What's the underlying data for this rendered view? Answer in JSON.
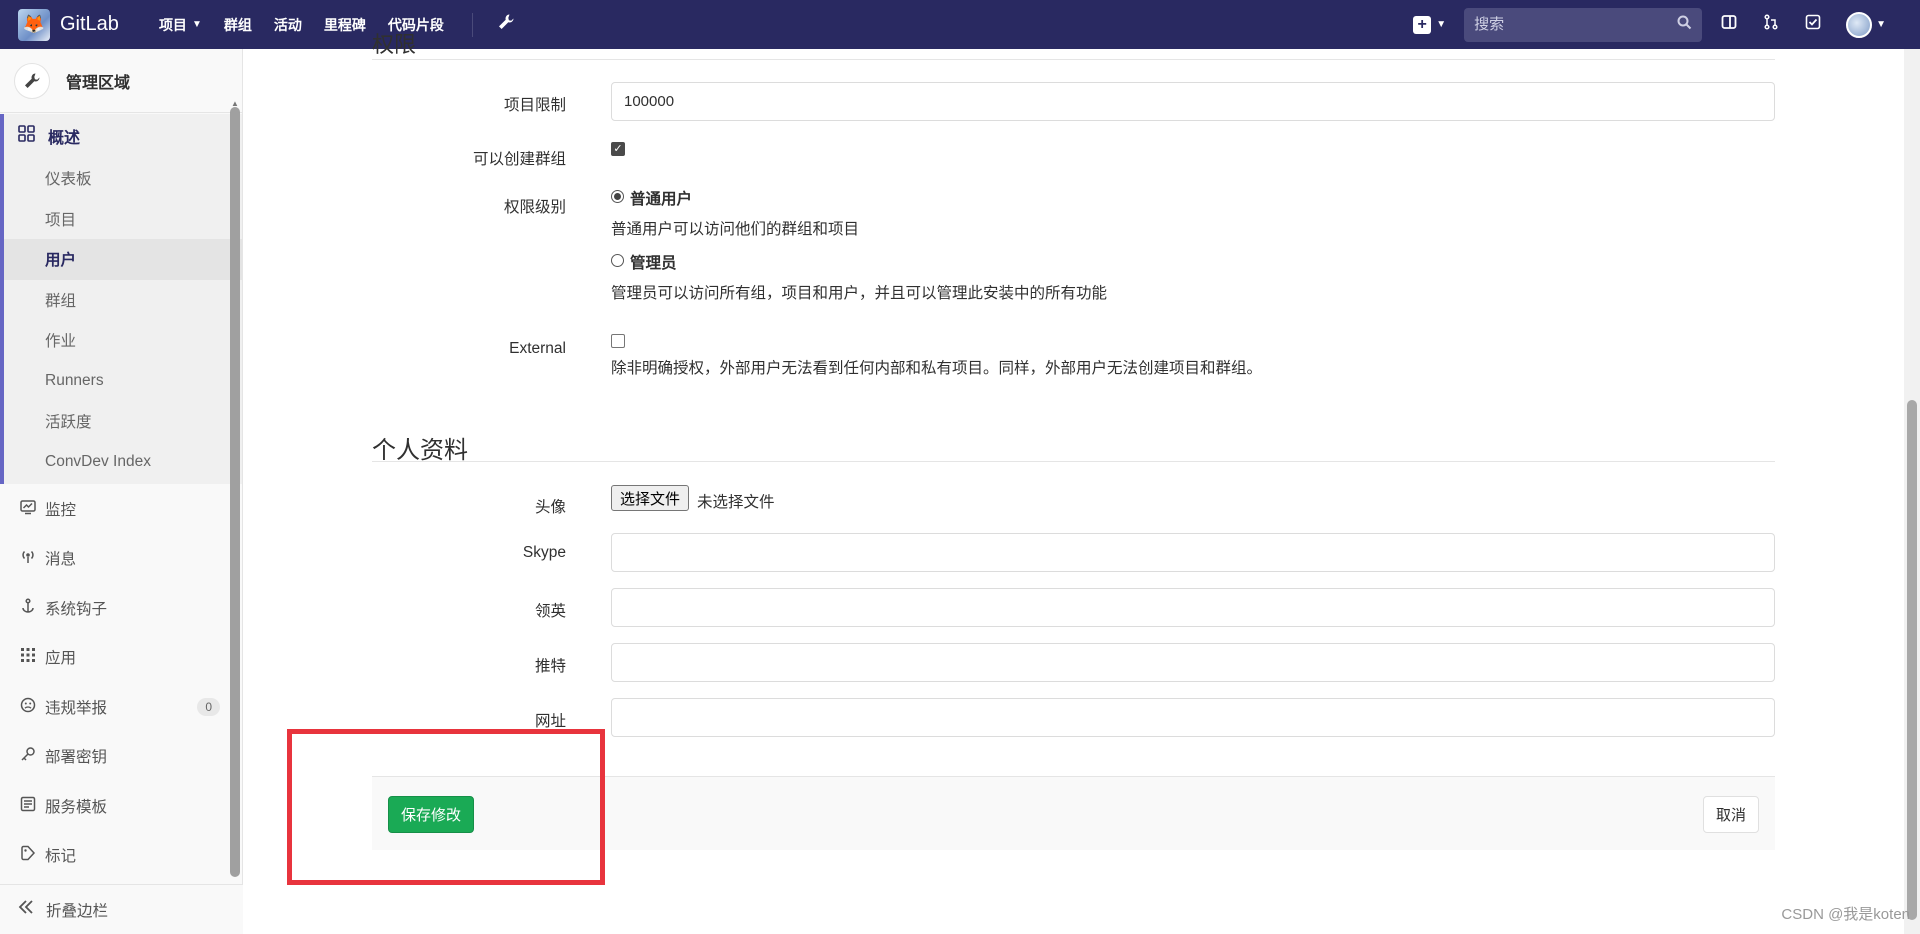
{
  "topnav": {
    "brand": "GitLab",
    "links": [
      {
        "label": "项目",
        "caret": true
      },
      {
        "label": "群组"
      },
      {
        "label": "活动"
      },
      {
        "label": "里程碑"
      },
      {
        "label": "代码片段"
      }
    ],
    "search_placeholder": "搜索"
  },
  "sidebar": {
    "header": "管理区域",
    "overview": "概述",
    "sub_items": [
      "仪表板",
      "项目",
      "用户",
      "群组",
      "作业",
      "Runners",
      "活跃度",
      "ConvDev Index"
    ],
    "active_sub": "用户",
    "items": [
      {
        "label": "监控",
        "icon": "monitor-icon"
      },
      {
        "label": "消息",
        "icon": "broadcast-icon"
      },
      {
        "label": "系统钩子",
        "icon": "anchor-icon"
      },
      {
        "label": "应用",
        "icon": "grid-icon"
      },
      {
        "label": "违规举报",
        "icon": "face-icon",
        "badge": "0"
      },
      {
        "label": "部署密钥",
        "icon": "key-icon"
      },
      {
        "label": "服务模板",
        "icon": "template-icon"
      },
      {
        "label": "标记",
        "icon": "label-icon"
      }
    ],
    "collapse": "折叠边栏"
  },
  "form": {
    "partial_heading": "权限",
    "projects_limit_label": "项目限制",
    "projects_limit_value": "100000",
    "can_create_group_label": "可以创建群组",
    "access_level_label": "权限级别",
    "regular_label": "普通用户",
    "regular_desc": "普通用户可以访问他们的群组和项目",
    "admin_label": "管理员",
    "admin_desc": "管理员可以访问所有组，项目和用户，并且可以管理此安装中的所有功能",
    "external_label": "External",
    "external_desc": "除非明确授权，外部用户无法看到任何内部和私有项目。同样，外部用户无法创建项目和群组。",
    "profile_title": "个人资料",
    "avatar_label": "头像",
    "choose_file": "选择文件",
    "no_file": "未选择文件",
    "skype_label": "Skype",
    "linkedin_label": "领英",
    "twitter_label": "推特",
    "website_label": "网址",
    "save": "保存修改",
    "cancel": "取消"
  },
  "watermark": "CSDN @我是koten",
  "colors": {
    "nav": "#292961",
    "save": "#1aaa55",
    "highlight": "#e8343d"
  }
}
